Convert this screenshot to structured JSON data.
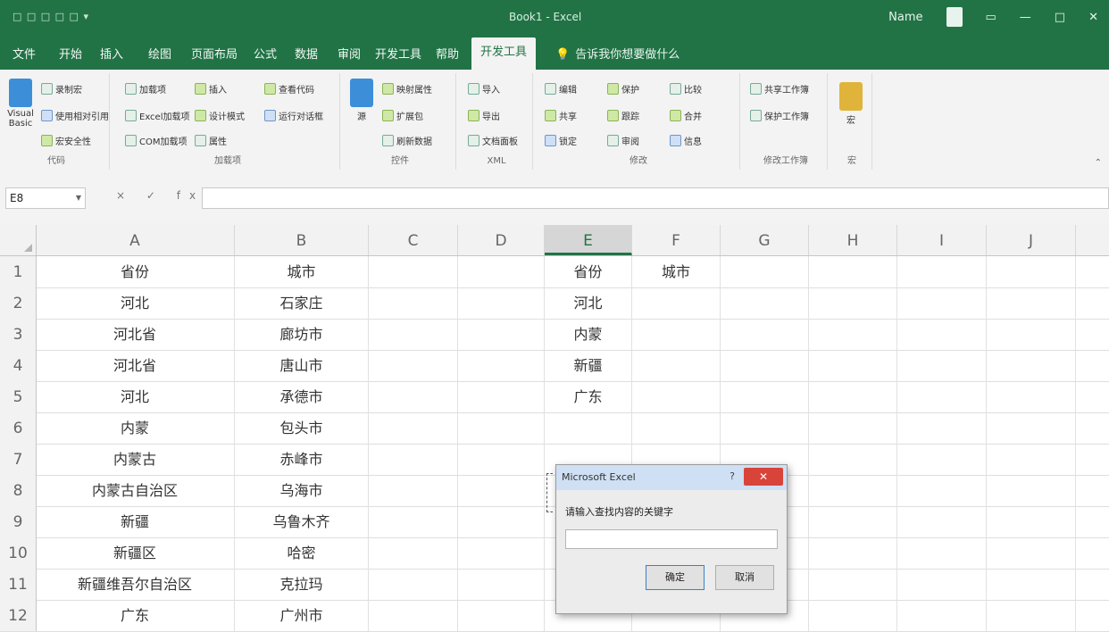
{
  "titlebar": {
    "quick_access": "□ □ □ □ □ ▾",
    "title": "Book1 - Excel",
    "user": "Name"
  },
  "tabs": [
    {
      "label": "文件"
    },
    {
      "label": "开始"
    },
    {
      "label": "插入"
    },
    {
      "label": "绘图"
    },
    {
      "label": "页面布局"
    },
    {
      "label": "公式"
    },
    {
      "label": "数据"
    },
    {
      "label": "审阅"
    },
    {
      "label": "开发工具"
    },
    {
      "label": "帮助"
    },
    {
      "label": "开发工具"
    }
  ],
  "tell_me": "告诉我你想要做什么",
  "ribbon": {
    "groups": [
      {
        "label": "代码",
        "big_button": "Visual Basic",
        "items": [
          "录制宏",
          "使用相对引用",
          "宏安全性"
        ]
      },
      {
        "label": "加载项",
        "items": [
          "加载项",
          "Excel加载项",
          "COM加载项",
          "插入",
          "设计模式",
          "属性",
          "查看代码",
          "运行对话框"
        ]
      },
      {
        "label": "控件",
        "big_button": "源",
        "items": [
          "映射属性",
          "扩展包",
          "刷新数据"
        ]
      },
      {
        "label": "XML",
        "items": [
          "导入",
          "导出",
          "文档面板"
        ]
      },
      {
        "label": "修改",
        "items": [
          "编辑",
          "共享",
          "锁定",
          "保护",
          "跟踪",
          "审阅",
          "比较",
          "合并",
          "信息"
        ]
      },
      {
        "label": "修改工作簿",
        "items": [
          "共享工作簿",
          "保护工作簿"
        ]
      },
      {
        "label": "宏",
        "big_button": "宏"
      }
    ]
  },
  "formula_bar": {
    "name_box": "E8",
    "fx_icons": "× ✓ fx",
    "value": ""
  },
  "columns": [
    "A",
    "B",
    "C",
    "D",
    "E",
    "F",
    "G",
    "H",
    "I",
    "J"
  ],
  "rows": [
    {
      "n": "1",
      "A": "省份",
      "B": "城市",
      "E": "省份",
      "F": "城市"
    },
    {
      "n": "2",
      "A": "河北",
      "B": "石家庄",
      "E": "河北"
    },
    {
      "n": "3",
      "A": "河北省",
      "B": "廊坊市",
      "E": "内蒙"
    },
    {
      "n": "4",
      "A": "河北省",
      "B": "唐山市",
      "E": "新疆"
    },
    {
      "n": "5",
      "A": "河北",
      "B": "承德市",
      "E": "广东"
    },
    {
      "n": "6",
      "A": "内蒙",
      "B": "包头市"
    },
    {
      "n": "7",
      "A": "内蒙古",
      "B": "赤峰市"
    },
    {
      "n": "8",
      "A": "内蒙古自治区",
      "B": "乌海市"
    },
    {
      "n": "9",
      "A": "新疆",
      "B": "乌鲁木齐"
    },
    {
      "n": "10",
      "A": "新疆区",
      "B": "哈密"
    },
    {
      "n": "11",
      "A": "新疆维吾尔自治区",
      "B": "克拉玛"
    },
    {
      "n": "12",
      "A": "广东",
      "B": "广州市"
    }
  ],
  "dialog": {
    "title": "Microsoft Excel",
    "help": "?",
    "close": "✕",
    "prompt": "请输入查找内容的关键字",
    "input_value": "",
    "ok": "确定",
    "cancel": "取消"
  }
}
